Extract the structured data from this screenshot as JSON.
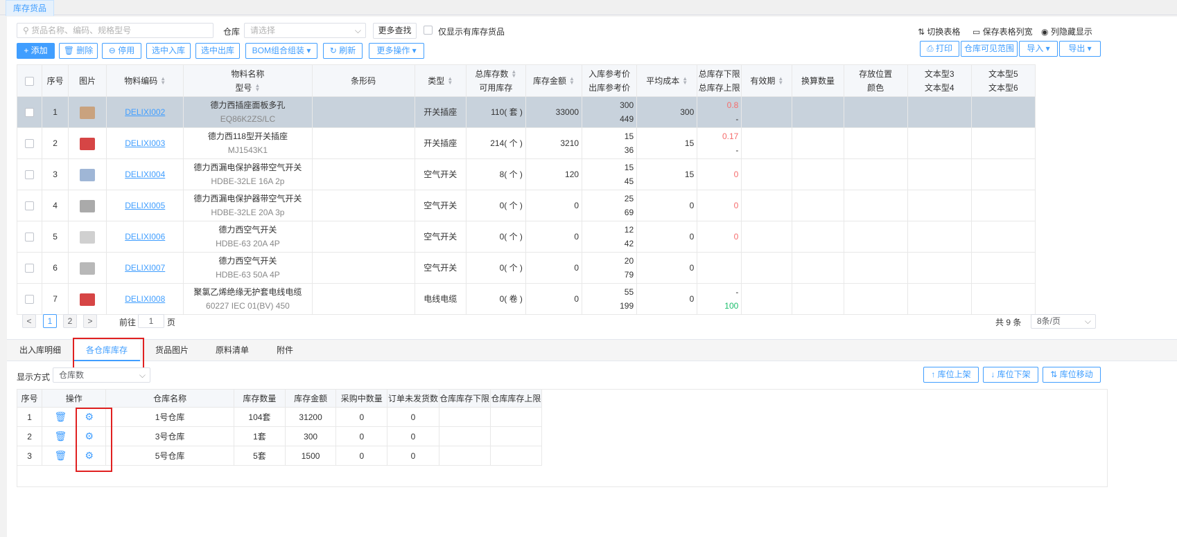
{
  "page_tab": "库存货品",
  "toolbar": {
    "search_placeholder": "货品名称、编码、规格型号",
    "warehouse_label": "仓库",
    "warehouse_placeholder": "请选择",
    "more_search": "更多查找",
    "only_stock_label": "仅显示有库存货品",
    "switch_table": "切换表格",
    "save_widths": "保存表格列宽",
    "hidden_cols": "列隐藏显示",
    "add": "添加",
    "delete": "删除",
    "disable": "停用",
    "selected_in": "选中入库",
    "selected_out": "选中出库",
    "bom": "BOM组合组装",
    "refresh": "刷新",
    "more_ops": "更多操作",
    "print": "打印",
    "visible_range": "仓库可见范围",
    "import": "导入",
    "export": "导出"
  },
  "columns": {
    "index": "序号",
    "image": "图片",
    "code": "物料编码",
    "name1": "物料名称",
    "name2": "型号",
    "barcode": "条形码",
    "type": "类型",
    "stock1": "总库存数",
    "stock2": "可用库存",
    "amount": "库存金额",
    "price1": "入库参考价",
    "price2": "出库参考价",
    "avg_cost": "平均成本",
    "limit1": "总库存下限",
    "limit2": "总库存上限",
    "expiry": "有效期",
    "conv": "换算数量",
    "loc1": "存放位置",
    "loc2": "颜色",
    "text34a": "文本型3",
    "text34b": "文本型4",
    "text56a": "文本型5",
    "text56b": "文本型6"
  },
  "rows": [
    {
      "idx": "1",
      "code": "DELIXI002",
      "name": "德力西插座面板多孔",
      "model": "EQ86K2ZS/LC",
      "type": "开关插座",
      "stock": "110( 套 )",
      "amount": "33000",
      "in_price": "300",
      "out_price": "449",
      "avg": "300",
      "lower": "0.8",
      "upper": "-"
    },
    {
      "idx": "2",
      "code": "DELIXI003",
      "name": "德力西118型开关插座",
      "model": "MJ1543K1",
      "type": "开关插座",
      "stock": "214( 个 )",
      "amount": "3210",
      "in_price": "15",
      "out_price": "36",
      "avg": "15",
      "lower": "0.17",
      "upper": "-"
    },
    {
      "idx": "3",
      "code": "DELIXI004",
      "name": "德力西漏电保护器带空气开关",
      "model": "HDBE-32LE 16A 2p",
      "type": "空气开关",
      "stock": "8( 个 )",
      "amount": "120",
      "in_price": "15",
      "out_price": "45",
      "avg": "15",
      "lower": "0",
      "upper": ""
    },
    {
      "idx": "4",
      "code": "DELIXI005",
      "name": "德力西漏电保护器带空气开关",
      "model": "HDBE-32LE 20A 3p",
      "type": "空气开关",
      "stock": "0( 个 )",
      "amount": "0",
      "in_price": "25",
      "out_price": "69",
      "avg": "0",
      "lower": "0",
      "upper": ""
    },
    {
      "idx": "5",
      "code": "DELIXI006",
      "name": "德力西空气开关",
      "model": "HDBE-63 20A 4P",
      "type": "空气开关",
      "stock": "0( 个 )",
      "amount": "0",
      "in_price": "12",
      "out_price": "42",
      "avg": "0",
      "lower": "0",
      "upper": ""
    },
    {
      "idx": "6",
      "code": "DELIXI007",
      "name": "德力西空气开关",
      "model": "HDBE-63 50A 4P",
      "type": "空气开关",
      "stock": "0( 个 )",
      "amount": "0",
      "in_price": "20",
      "out_price": "79",
      "avg": "0",
      "lower": "",
      "upper": ""
    },
    {
      "idx": "7",
      "code": "DELIXI008",
      "name": "聚氯乙烯绝缘无护套电线电缆",
      "model": "60227 IEC 01(BV) 450",
      "type": "电线电缆",
      "stock": "0( 卷 )",
      "amount": "0",
      "in_price": "55",
      "out_price": "199",
      "avg": "0",
      "lower": "-",
      "upper": "100"
    }
  ],
  "pager": {
    "page1": "1",
    "page2": "2",
    "goto_label": "前往",
    "goto_value": "1",
    "page_unit": "页",
    "total": "共 9 条",
    "page_size": "8条/页"
  },
  "tabs": [
    "出入库明细",
    "各仓库库存",
    "货品图片",
    "原料清单",
    "附件"
  ],
  "display_mode": {
    "label": "显示方式",
    "value": "仓库数"
  },
  "shelf_buttons": {
    "up": "库位上架",
    "down": "库位下架",
    "move": "库位移动"
  },
  "wh_columns": {
    "idx": "序号",
    "op": "操作",
    "name": "仓库名称",
    "qty": "库存数量",
    "amount": "库存金额",
    "purchasing": "采购中数量",
    "unshipped": "订单未发货数",
    "lower": "仓库库存下限",
    "upper": "仓库库存上限"
  },
  "wh_rows": [
    {
      "idx": "1",
      "name": "1号仓库",
      "qty": "104套",
      "amount": "31200",
      "purchasing": "0",
      "unshipped": "0"
    },
    {
      "idx": "2",
      "name": "3号仓库",
      "qty": "1套",
      "amount": "300",
      "purchasing": "0",
      "unshipped": "0"
    },
    {
      "idx": "3",
      "name": "5号仓库",
      "qty": "5套",
      "amount": "1500",
      "purchasing": "0",
      "unshipped": "0"
    }
  ],
  "colors": {
    "accent": "#409eff",
    "selected_row": "#c8d2dc",
    "red": "#f56c6c",
    "green": "#19be6b",
    "highlight": "#e02020"
  }
}
